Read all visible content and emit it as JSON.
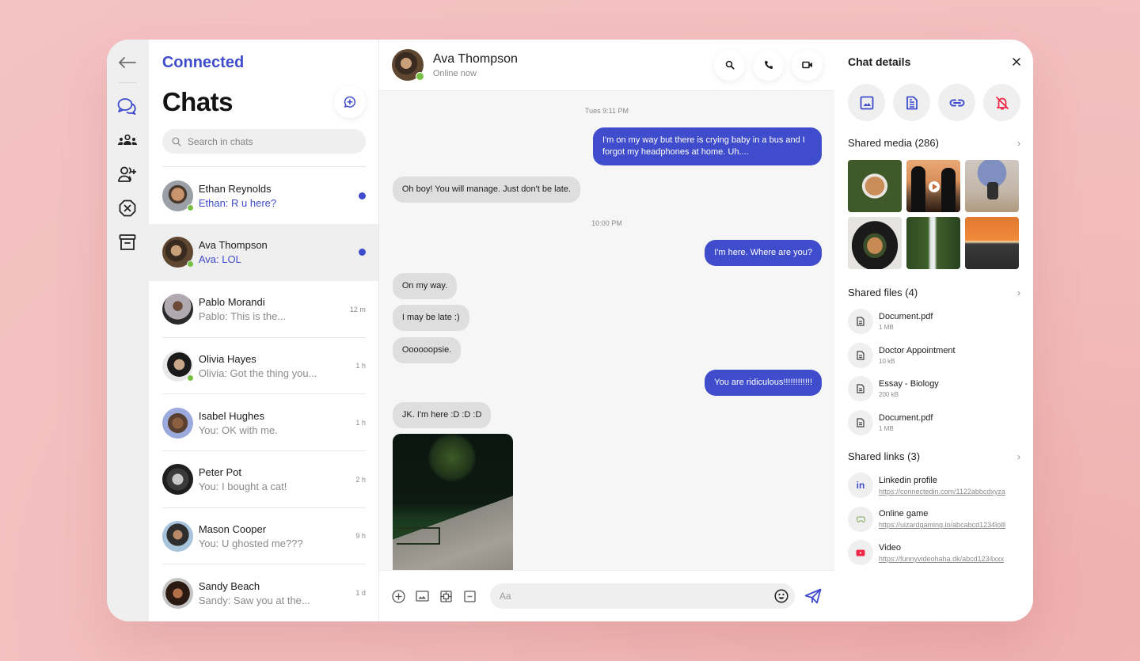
{
  "app": {
    "brand": "Connected",
    "accent_color": "#3f4ccc",
    "online_color": "#76c043",
    "mute_color": "#f0284a"
  },
  "rail": {
    "items": [
      {
        "name": "back",
        "icon": "arrow-left-icon"
      },
      {
        "name": "chats",
        "icon": "chat-bubbles-icon",
        "active": true
      },
      {
        "name": "groups",
        "icon": "people-group-icon"
      },
      {
        "name": "add-contact",
        "icon": "user-plus-icon"
      },
      {
        "name": "blocked",
        "icon": "octagon-x-icon"
      },
      {
        "name": "archive",
        "icon": "archive-box-icon"
      }
    ]
  },
  "chat_list": {
    "title": "Chats",
    "search_placeholder": "Search in chats",
    "new_chat_icon": "chat-plus-icon",
    "items": [
      {
        "name": "Ethan Reynolds",
        "preview": "Ethan: R u here?",
        "time": "",
        "unread": true,
        "online": true
      },
      {
        "name": "Ava Thompson",
        "preview": "Ava: LOL",
        "time": "",
        "unread": true,
        "online": true,
        "active": true
      },
      {
        "name": "Pablo Morandi",
        "preview": "Pablo: This is the...",
        "time": "12 m",
        "unread": false,
        "online": false
      },
      {
        "name": "Olivia Hayes",
        "preview": "Olivia: Got the thing you...",
        "time": "1 h",
        "unread": false,
        "online": true
      },
      {
        "name": "Isabel Hughes",
        "preview": "You: OK with me.",
        "time": "1 h",
        "unread": false,
        "online": false
      },
      {
        "name": "Peter Pot",
        "preview": "You: I bought a cat!",
        "time": "2 h",
        "unread": false,
        "online": false
      },
      {
        "name": "Mason Cooper",
        "preview": "You: U ghosted me???",
        "time": "9 h",
        "unread": false,
        "online": false
      },
      {
        "name": "Sandy Beach",
        "preview": "Sandy: Saw you at the...",
        "time": "1 d",
        "unread": false,
        "online": false
      }
    ]
  },
  "conversation": {
    "contact_name": "Ava Thompson",
    "status": "Online now",
    "actions": [
      "search-icon",
      "phone-icon",
      "video-camera-icon"
    ],
    "timestamps": [
      "Tues 9:11 PM",
      "10:00 PM"
    ],
    "messages": [
      {
        "dir": "out",
        "text": "I'm on my way but there is crying baby in a bus and I forgot my headphones at home. Uh...."
      },
      {
        "dir": "in",
        "text": "Oh boy! You will manage. Just don't be late."
      },
      {
        "dir": "out",
        "text": "I'm here. Where are you?"
      },
      {
        "dir": "in",
        "text": "On my way."
      },
      {
        "dir": "in",
        "text": "I may be late :)"
      },
      {
        "dir": "in",
        "text": "Oooooopsie."
      },
      {
        "dir": "out",
        "text": "You are ridiculous!!!!!!!!!!!!"
      },
      {
        "dir": "in",
        "text": "JK. I'm here :D :D :D"
      },
      {
        "dir": "in",
        "type": "image",
        "alt": "Night park path with bench"
      }
    ],
    "composer": {
      "placeholder": "Aa",
      "tools": [
        "plus-circle-icon",
        "image-icon",
        "sticker-icon",
        "gif-icon"
      ],
      "emoji_icon": "smiley-icon",
      "send_icon": "send-icon"
    }
  },
  "details": {
    "title": "Chat details",
    "quick_actions": [
      "image-icon",
      "document-icon",
      "link-icon",
      "bell-off-icon"
    ],
    "shared_media": {
      "label": "Shared media (286)",
      "items": [
        {
          "alt": "Dog lying in grass",
          "video": false
        },
        {
          "alt": "Two people at sunset",
          "video": true
        },
        {
          "alt": "Person sitting at beach",
          "video": false
        },
        {
          "alt": "Plate of food",
          "video": false
        },
        {
          "alt": "Waterfall",
          "video": false
        },
        {
          "alt": "Sunset over sea",
          "video": false
        }
      ]
    },
    "shared_files": {
      "label": "Shared files (4)",
      "items": [
        {
          "name": "Document.pdf",
          "size": "1 MB"
        },
        {
          "name": "Doctor Appointment",
          "size": "10 kB"
        },
        {
          "name": "Essay - Biology",
          "size": "200 kB"
        },
        {
          "name": "Document.pdf",
          "size": "1 MB"
        }
      ]
    },
    "shared_links": {
      "label": "Shared links (3)",
      "items": [
        {
          "title": "Linkedin profile",
          "url": "https://connectedin.com/1122abbcdxyza",
          "icon": "linkedin-icon"
        },
        {
          "title": "Online game",
          "url": "https://uizardgaming.io/abcabcd1234lolll",
          "icon": "gamepad-icon"
        },
        {
          "title": "Video",
          "url": "https://funnyvideohaha.dk/abcd1234xxx",
          "icon": "youtube-icon"
        }
      ]
    }
  }
}
